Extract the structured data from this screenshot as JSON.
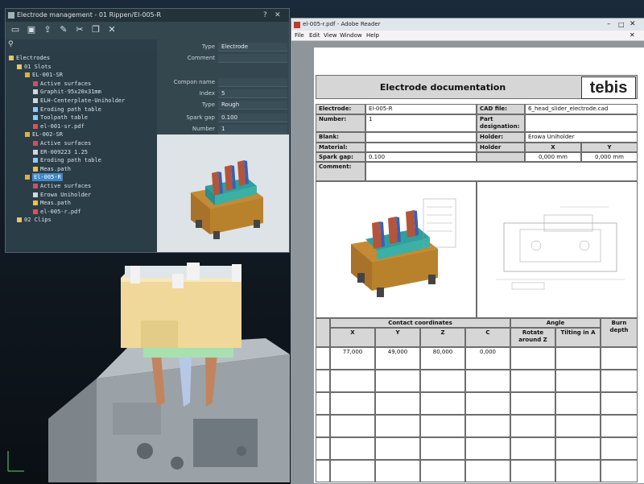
{
  "colors": {
    "accent": "#3f86c8",
    "panel_bg": "#2c3e48",
    "electrode_orange": "#b8822c",
    "copper": "#b4543a",
    "teal": "#2f9fa0"
  },
  "em_window": {
    "title": "Electrode management - 01 Rippen/El-005-R",
    "help_button": "?",
    "close_button": "✕",
    "toolbar_icons": [
      "save-icon",
      "save-as-icon",
      "export-icon",
      "edit-icon",
      "cut-icon",
      "copy-icon",
      "delete-icon"
    ],
    "search_icon": "search-icon",
    "tree": [
      {
        "label": "Electrodes",
        "icon": "folder-open-icon"
      },
      {
        "label": "01 Slots",
        "icon": "folder-open-icon"
      },
      {
        "label": "EL-001-SR",
        "icon": "electrode-icon"
      },
      {
        "label": "Active surfaces",
        "icon": "surface-icon"
      },
      {
        "label": "Graphit-95x20x31mm",
        "icon": "blank-icon"
      },
      {
        "label": "ELH-Centerplate-Uniholder",
        "icon": "holder-icon"
      },
      {
        "label": "Eroding path table",
        "icon": "table-icon"
      },
      {
        "label": "Toolpath table",
        "icon": "table-icon"
      },
      {
        "label": "el-001-sr.pdf",
        "icon": "pdf-icon"
      },
      {
        "label": "EL-002-SR",
        "icon": "electrode-icon"
      },
      {
        "label": "Active surfaces",
        "icon": "surface-icon"
      },
      {
        "label": "ER-009223 1.25",
        "icon": "holder-icon"
      },
      {
        "label": "Eroding path table",
        "icon": "table-icon"
      },
      {
        "label": "Meas.path",
        "icon": "probe-icon"
      },
      {
        "label": "El-005-R",
        "icon": "electrode-icon"
      },
      {
        "label": "Active surfaces",
        "icon": "surface-icon"
      },
      {
        "label": "Erowa Uniholder",
        "icon": "holder-icon"
      },
      {
        "label": "Meas.path",
        "icon": "probe-icon"
      },
      {
        "label": "el-005-r.pdf",
        "icon": "pdf-icon"
      },
      {
        "label": "02 Clips",
        "icon": "folder-icon"
      }
    ],
    "props": [
      {
        "label": "Type",
        "value": "Electrode"
      },
      {
        "label": "Comment",
        "value": ""
      },
      {
        "label": "Compon name",
        "value": ""
      },
      {
        "label": "Index",
        "value": "5"
      },
      {
        "label": "Type",
        "value": "Rough"
      },
      {
        "label": "Spark gap",
        "value": "0.100"
      },
      {
        "label": "Number",
        "value": "1"
      }
    ]
  },
  "reader": {
    "title": "el-005-r.pdf - Adobe Reader",
    "menu": [
      "File",
      "Edit",
      "View",
      "Window",
      "Help"
    ],
    "doc": {
      "heading": "Electrode documentation",
      "logo": "tebis",
      "rows": {
        "electrode_label": "Electrode:",
        "electrode": "El-005-R",
        "cad_label": "CAD file:",
        "cad": "6_head_slider_electrode.cad",
        "number_label": "Number:",
        "number": "1",
        "part_label": "Part designation:",
        "part": "",
        "blank_label": "Blank:",
        "blank": "",
        "holder_label": "Holder:",
        "holder": "Erowa Uniholder",
        "material_label": "Material:",
        "material": "",
        "holder_displ_label": "Holder displ.:",
        "x_label": "X",
        "y_label": "Y",
        "spark_label": "Spark gap:",
        "spark": "0.100",
        "x_val": "0,000 mm",
        "y_val": "0,000 mm",
        "comment_label": "Comment:",
        "comment": ""
      },
      "contact": {
        "group_label": "Contact coordinates",
        "angle_label": "Angle",
        "columns": [
          "X",
          "Y",
          "Z",
          "C",
          "Rotate around Z",
          "Tilting in A",
          "Burn depth"
        ],
        "rows": [
          [
            "77,000",
            "49,000",
            "80,000",
            "0,000",
            "",
            "",
            ""
          ],
          [
            "",
            "",
            "",
            "",
            "",
            "",
            ""
          ],
          [
            "",
            "",
            "",
            "",
            "",
            "",
            ""
          ],
          [
            "",
            "",
            "",
            "",
            "",
            "",
            ""
          ],
          [
            "",
            "",
            "",
            "",
            "",
            "",
            ""
          ],
          [
            "",
            "",
            "",
            "",
            "",
            "",
            ""
          ]
        ]
      }
    }
  }
}
